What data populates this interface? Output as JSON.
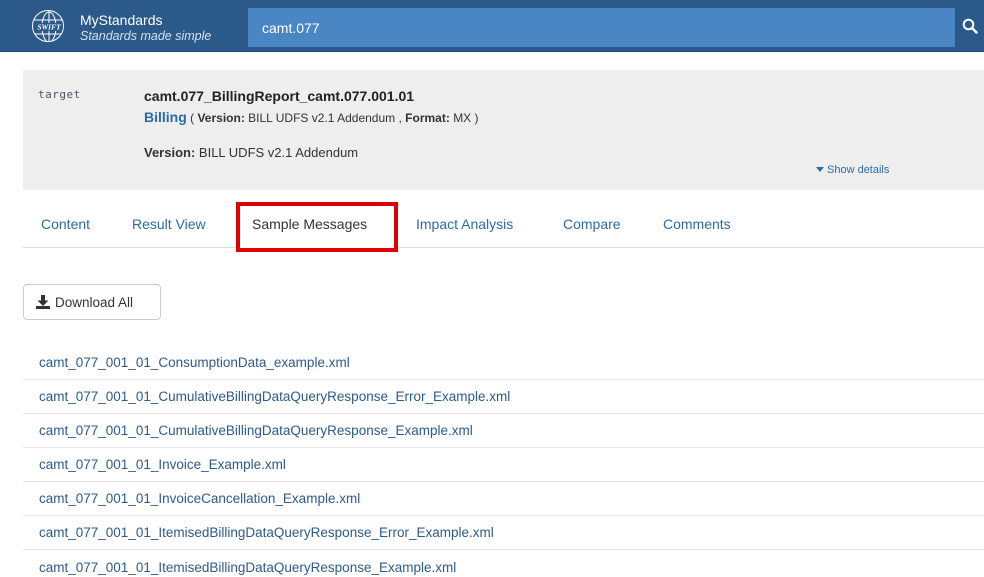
{
  "header": {
    "brand_name": "MyStandards",
    "brand_tagline": "Standards made simple",
    "logo_text": "SWIFT",
    "search_value": "camt.077"
  },
  "info": {
    "publisher_logo_text": "target",
    "message_title": "camt.077_BillingReport_camt.077.001.01",
    "collection_link": "Billing",
    "version_label": "Version:",
    "version_value": "BILL UDFS v2.1 Addendum",
    "format_label": "Format:",
    "format_value": "MX",
    "version_line_label": "Version:",
    "version_line_value": "BILL UDFS v2.1 Addendum",
    "show_details": "Show details"
  },
  "tabs": [
    {
      "label": "Content"
    },
    {
      "label": "Result View"
    },
    {
      "label": "Sample Messages",
      "active": true
    },
    {
      "label": "Impact Analysis"
    },
    {
      "label": "Compare"
    },
    {
      "label": "Comments"
    }
  ],
  "download_all_label": "Download All",
  "files": [
    "camt_077_001_01_ConsumptionData_example.xml",
    "camt_077_001_01_CumulativeBillingDataQueryResponse_Error_Example.xml",
    "camt_077_001_01_CumulativeBillingDataQueryResponse_Example.xml",
    "camt_077_001_01_Invoice_Example.xml",
    "camt_077_001_01_InvoiceCancellation_Example.xml",
    "camt_077_001_01_ItemisedBillingDataQueryResponse_Error_Example.xml",
    "camt_077_001_01_ItemisedBillingDataQueryResponse_Example.xml"
  ],
  "colors": {
    "header_bg": "#2b5a8a",
    "search_bg": "#4a86c4",
    "link": "#2d6ca2",
    "highlight": "#e10000"
  },
  "icons": {
    "search": "search-icon",
    "download": "download-icon",
    "caret": "caret-down-icon",
    "logo": "swift-globe-icon"
  }
}
